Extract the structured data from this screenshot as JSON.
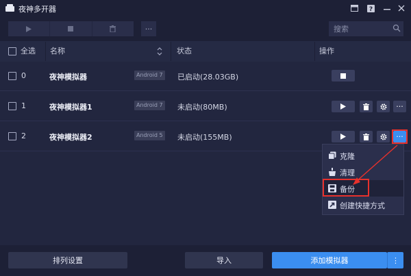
{
  "window": {
    "title": "夜神多开器"
  },
  "toolbar": {
    "more_label": "···",
    "search_placeholder": "搜索"
  },
  "table": {
    "select_all": "全选",
    "col_name": "名称",
    "col_status": "状态",
    "col_actions": "操作",
    "rows": [
      {
        "index": "0",
        "name": "夜神模拟器",
        "android": "Android 7",
        "status": "已启动(28.03GB)"
      },
      {
        "index": "1",
        "name": "夜神模拟器1",
        "android": "Android 7",
        "status": "未启动(80MB)"
      },
      {
        "index": "2",
        "name": "夜神模拟器2",
        "android": "Android 5",
        "status": "未启动(155MB)"
      }
    ],
    "more_label": "···"
  },
  "context_menu": {
    "items": [
      {
        "label": "克隆",
        "icon": "clone-icon"
      },
      {
        "label": "清理",
        "icon": "broom-icon"
      },
      {
        "label": "备份",
        "icon": "save-icon"
      },
      {
        "label": "创建快捷方式",
        "icon": "shortcut-icon"
      }
    ]
  },
  "bottom": {
    "arrange_label": "排列设置",
    "import_label": "导入",
    "add_label": "添加模拟器",
    "more_label": "⋮"
  },
  "colors": {
    "background": "#22263f",
    "bar": "#1d2036",
    "primary": "#3b8ef0",
    "highlight": "#e8312c"
  }
}
